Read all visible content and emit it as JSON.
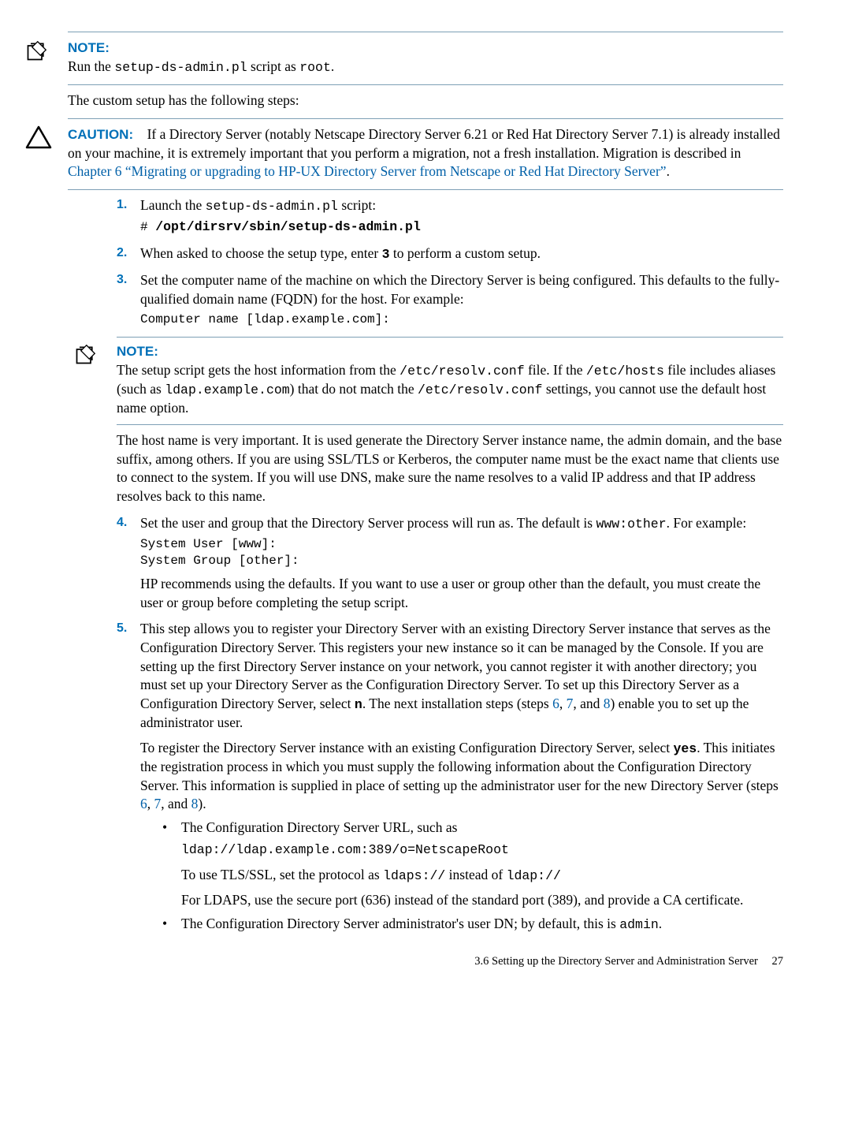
{
  "note1": {
    "heading": "NOTE:",
    "body_pre": "Run the ",
    "body_code1": "setup-ds-admin.pl",
    "body_mid": " script as ",
    "body_code2": "root",
    "body_post": "."
  },
  "intro_line": "The custom setup has the following steps:",
  "caution": {
    "heading": "CAUTION:",
    "text1": "If a Directory Server (notably Netscape Directory Server 6.21 or Red Hat Directory Server 7.1) is already installed on your machine, it is extremely important that you perform a migration, not a fresh installation. Migration is described in ",
    "link": "Chapter 6 “Migrating or upgrading to HP-UX Directory Server from Netscape or Red Hat Directory Server”",
    "text2": "."
  },
  "steps": {
    "s1": {
      "num": "1.",
      "text_pre": "Launch the ",
      "code": "setup-ds-admin.pl",
      "text_post": " script:",
      "cmd_hash": "# ",
      "cmd": "/opt/dirsrv/sbin/setup-ds-admin.pl"
    },
    "s2": {
      "num": "2.",
      "text_pre": "When asked to choose the setup type, enter ",
      "code": "3",
      "text_post": " to perform a custom setup."
    },
    "s3": {
      "num": "3.",
      "text": "Set the computer name of the machine on which the Directory Server is being configured. This defaults to the fully-qualified domain name (FQDN) for the host. For example:",
      "code": "Computer name [ldap.example.com]:"
    },
    "note2": {
      "heading": "NOTE:",
      "t1": "The setup script gets the host information from the ",
      "c1": "/etc/resolv.conf",
      "t2": " file. If the ",
      "c2": "/etc/hosts",
      "t3": " file includes aliases (such as ",
      "c3": "ldap.example.com",
      "t4": ") that do not match the ",
      "c4": "/etc/resolv.conf",
      "t5": " settings, you cannot use the default host name option."
    },
    "s3_followup": "The host name is very important. It is used generate the Directory Server instance name, the admin domain, and the base suffix, among others. If you are using SSL/TLS or Kerberos, the computer name must be the exact name that clients use to connect to the system. If you will use DNS, make sure the name resolves to a valid IP address and that IP address resolves back to this name.",
    "s4": {
      "num": "4.",
      "t1": "Set the user and group that the Directory Server process will run as. The default is ",
      "c1": "www:other",
      "t2": ". For example:",
      "code": "System User [www]:\nSystem Group [other]:",
      "t3": "HP recommends using the defaults. If you want to use a user or group other than the default, you must create the user or group before completing the setup script."
    },
    "s5": {
      "num": "5.",
      "p1a": "This step allows you to register your Directory Server with an existing Directory Server instance that serves as the Configuration Directory Server. This registers your new instance so it can be managed by the Console. If you are setting up the first Directory Server instance on your network, you cannot register it with another directory; you must set up your Directory Server as the Configuration Directory Server. To set up this Directory Server as a Configuration Directory Server, select ",
      "c1": "n",
      "p1b": ". The next installation steps (steps ",
      "l6a": "6",
      "comma1": ", ",
      "l7a": "7",
      "and1": ", and ",
      "l8a": "8",
      "p1c": ") enable you to set up the administrator user.",
      "p2a": "To register the Directory Server instance with an existing Configuration Directory Server, select ",
      "c2": "yes",
      "p2b": ". This initiates the registration process in which you must supply the following information about the Configuration Directory Server. This information is supplied in place of setting up the administrator user for the new Directory Server (steps ",
      "l6b": "6",
      "comma2": ", ",
      "l7b": "7",
      "and2": ", and ",
      "l8b": "8",
      "p2c": ").",
      "b1": {
        "t1": "The Configuration Directory Server URL, such as",
        "c1": "ldap://ldap.example.com:389/o=NetscapeRoot",
        "t2a": "To use TLS/SSL, set the protocol as ",
        "c2": "ldaps://",
        "t2b": " instead of ",
        "c3": "ldap://",
        "t3": "For LDAPS, use the secure port (636) instead of the standard port (389), and provide a CA certificate."
      },
      "b2": {
        "t1": "The Configuration Directory Server administrator's user DN; by default, this is ",
        "c1": "admin",
        "t2": "."
      }
    }
  },
  "footer": {
    "text": "3.6 Setting up the Directory Server and Administration Server",
    "page": "27"
  }
}
